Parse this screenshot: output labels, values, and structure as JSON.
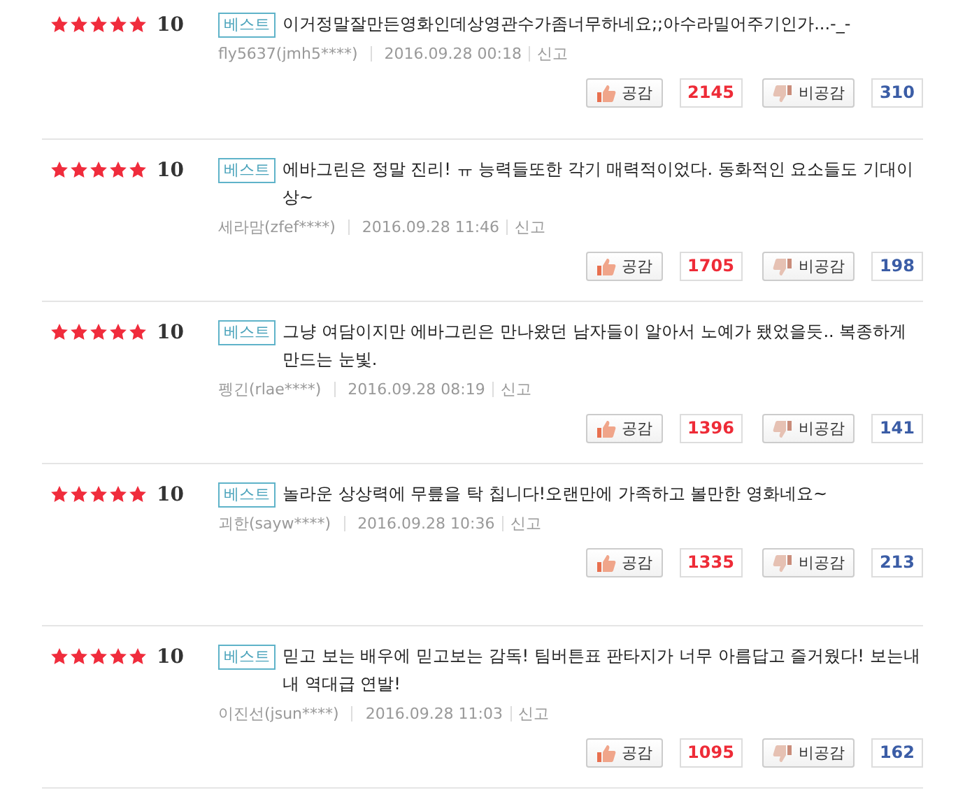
{
  "reviews": [
    {
      "stars": 5,
      "score": "10",
      "badge": "베스트",
      "text": "이거정말잘만든영화인데상영관수가좀너무하네요;;아수라밀어주기인가...-_-",
      "author": "fly5637(jmh5****)",
      "date": "2016.09.28 00:18",
      "report": "신고",
      "like_label": "공감",
      "likes": "2145",
      "dislike_label": "비공감",
      "dislikes": "310"
    },
    {
      "stars": 5,
      "score": "10",
      "badge": "베스트",
      "text": "에바그린은 정말 진리! ㅠ 능력들또한 각기 매력적이었다. 동화적인 요소들도 기대이상~",
      "author": "세라맘(zfef****)",
      "date": "2016.09.28 11:46",
      "report": "신고",
      "like_label": "공감",
      "likes": "1705",
      "dislike_label": "비공감",
      "dislikes": "198"
    },
    {
      "stars": 5,
      "score": "10",
      "badge": "베스트",
      "text": "그냥 여담이지만 에바그린은 만나왔던 남자들이 알아서 노예가 됐었을듯.. 복종하게 만드는 눈빛.",
      "author": "펭긴(rlae****)",
      "date": "2016.09.28 08:19",
      "report": "신고",
      "like_label": "공감",
      "likes": "1396",
      "dislike_label": "비공감",
      "dislikes": "141"
    },
    {
      "stars": 5,
      "score": "10",
      "badge": "베스트",
      "text": "놀라운 상상력에 무릎을 탁 칩니다!오랜만에 가족하고 볼만한 영화네요~",
      "author": "괴한(sayw****)",
      "date": "2016.09.28 10:36",
      "report": "신고",
      "like_label": "공감",
      "likes": "1335",
      "dislike_label": "비공감",
      "dislikes": "213"
    },
    {
      "stars": 5,
      "score": "10",
      "badge": "베스트",
      "text": "믿고 보는 배우에 믿고보는 감독! 팀버튼표 판타지가 너무 아름답고 즐거웠다! 보는내내 역대급 연발!",
      "author": "이진선(jsun****)",
      "date": "2016.09.28 11:03",
      "report": "신고",
      "like_label": "공감",
      "likes": "1095",
      "dislike_label": "비공감",
      "dislikes": "162"
    }
  ]
}
